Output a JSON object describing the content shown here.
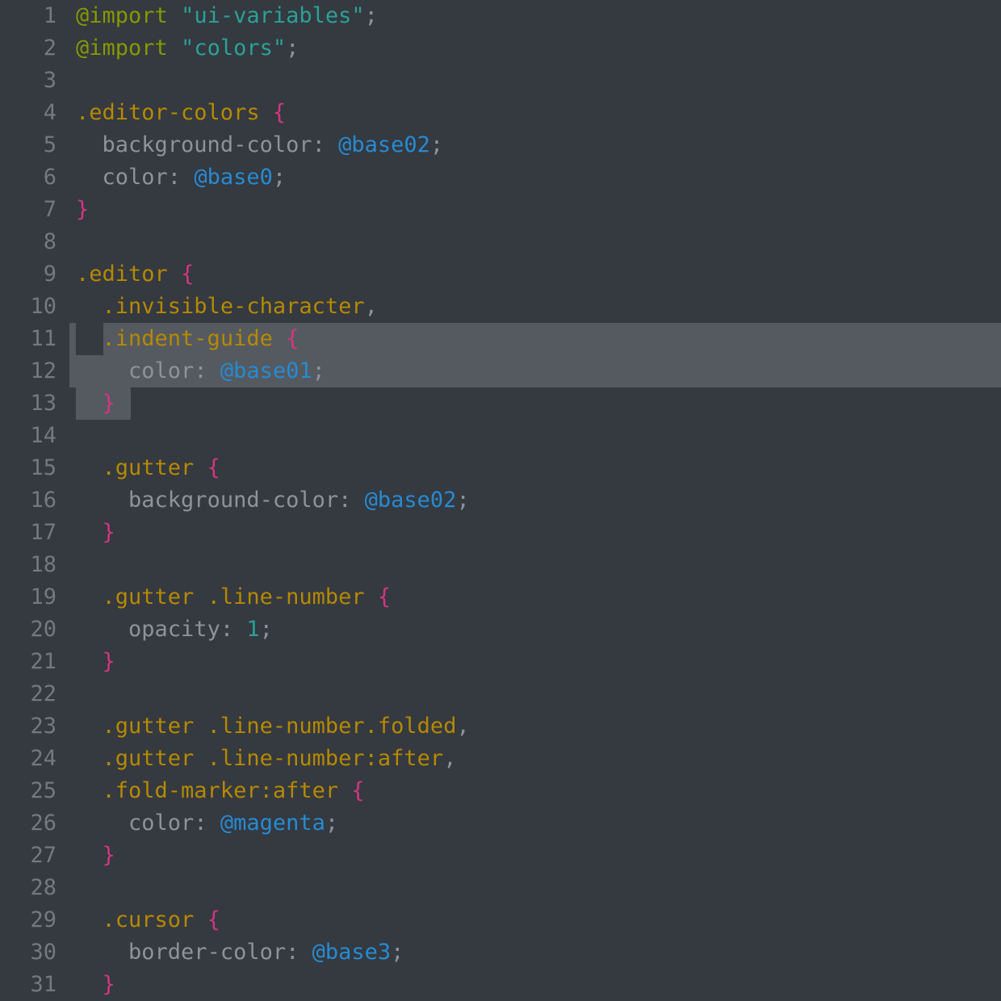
{
  "theme": {
    "background": "#353940",
    "selection": "#555a60",
    "gutterText": "#75797f",
    "defaultText": "#8e9299",
    "keyword": "#d33682",
    "atrule": "#859900",
    "string": "#2aa198",
    "class": "#b58900",
    "variable": "#268bd2",
    "number": "#2aa198"
  },
  "selection": {
    "startLine": 11,
    "endLine": 13
  },
  "lines": [
    {
      "n": 1,
      "indent": "",
      "tokens": [
        [
          "atrule",
          "@import"
        ],
        [
          "punct",
          " "
        ],
        [
          "string",
          "\"ui-variables\""
        ],
        [
          "punct",
          ";"
        ]
      ]
    },
    {
      "n": 2,
      "indent": "",
      "tokens": [
        [
          "atrule",
          "@import"
        ],
        [
          "punct",
          " "
        ],
        [
          "string",
          "\"colors\""
        ],
        [
          "punct",
          ";"
        ]
      ]
    },
    {
      "n": 3,
      "indent": "",
      "tokens": []
    },
    {
      "n": 4,
      "indent": "",
      "tokens": [
        [
          "class",
          ".editor-colors"
        ],
        [
          "punct",
          " "
        ],
        [
          "brace",
          "{"
        ]
      ]
    },
    {
      "n": 5,
      "indent": "  ",
      "tokens": [
        [
          "prop",
          "background-color"
        ],
        [
          "punct",
          ": "
        ],
        [
          "var",
          "@base02"
        ],
        [
          "punct",
          ";"
        ]
      ]
    },
    {
      "n": 6,
      "indent": "  ",
      "tokens": [
        [
          "prop",
          "color"
        ],
        [
          "punct",
          ": "
        ],
        [
          "var",
          "@base0"
        ],
        [
          "punct",
          ";"
        ]
      ]
    },
    {
      "n": 7,
      "indent": "",
      "tokens": [
        [
          "brace",
          "}"
        ]
      ]
    },
    {
      "n": 8,
      "indent": "",
      "tokens": []
    },
    {
      "n": 9,
      "indent": "",
      "tokens": [
        [
          "class",
          ".editor"
        ],
        [
          "punct",
          " "
        ],
        [
          "brace",
          "{"
        ]
      ]
    },
    {
      "n": 10,
      "indent": "  ",
      "tokens": [
        [
          "class",
          ".invisible-character"
        ],
        [
          "punct",
          ","
        ]
      ]
    },
    {
      "n": 11,
      "indent": "  ",
      "tokens": [
        [
          "class",
          ".indent-guide"
        ],
        [
          "punct",
          " "
        ],
        [
          "brace",
          "{"
        ]
      ]
    },
    {
      "n": 12,
      "indent": "    ",
      "tokens": [
        [
          "prop",
          "color"
        ],
        [
          "punct",
          ": "
        ],
        [
          "var",
          "@base01"
        ],
        [
          "punct",
          ";"
        ]
      ]
    },
    {
      "n": 13,
      "indent": "  ",
      "tokens": [
        [
          "brace",
          "}"
        ]
      ]
    },
    {
      "n": 14,
      "indent": "",
      "tokens": []
    },
    {
      "n": 15,
      "indent": "  ",
      "tokens": [
        [
          "class",
          ".gutter"
        ],
        [
          "punct",
          " "
        ],
        [
          "brace",
          "{"
        ]
      ]
    },
    {
      "n": 16,
      "indent": "    ",
      "tokens": [
        [
          "prop",
          "background-color"
        ],
        [
          "punct",
          ": "
        ],
        [
          "var",
          "@base02"
        ],
        [
          "punct",
          ";"
        ]
      ]
    },
    {
      "n": 17,
      "indent": "  ",
      "tokens": [
        [
          "brace",
          "}"
        ]
      ]
    },
    {
      "n": 18,
      "indent": "",
      "tokens": []
    },
    {
      "n": 19,
      "indent": "  ",
      "tokens": [
        [
          "class",
          ".gutter"
        ],
        [
          "punct",
          " "
        ],
        [
          "class",
          ".line-number"
        ],
        [
          "punct",
          " "
        ],
        [
          "brace",
          "{"
        ]
      ]
    },
    {
      "n": 20,
      "indent": "    ",
      "tokens": [
        [
          "prop",
          "opacity"
        ],
        [
          "punct",
          ": "
        ],
        [
          "num",
          "1"
        ],
        [
          "punct",
          ";"
        ]
      ]
    },
    {
      "n": 21,
      "indent": "  ",
      "tokens": [
        [
          "brace",
          "}"
        ]
      ]
    },
    {
      "n": 22,
      "indent": "",
      "tokens": []
    },
    {
      "n": 23,
      "indent": "  ",
      "tokens": [
        [
          "class",
          ".gutter"
        ],
        [
          "punct",
          " "
        ],
        [
          "class",
          ".line-number"
        ],
        [
          "class",
          ".folded"
        ],
        [
          "punct",
          ","
        ]
      ]
    },
    {
      "n": 24,
      "indent": "  ",
      "tokens": [
        [
          "class",
          ".gutter"
        ],
        [
          "punct",
          " "
        ],
        [
          "class",
          ".line-number"
        ],
        [
          "pseudo",
          ":after"
        ],
        [
          "punct",
          ","
        ]
      ]
    },
    {
      "n": 25,
      "indent": "  ",
      "tokens": [
        [
          "class",
          ".fold-marker"
        ],
        [
          "pseudo",
          ":after"
        ],
        [
          "punct",
          " "
        ],
        [
          "brace",
          "{"
        ]
      ]
    },
    {
      "n": 26,
      "indent": "    ",
      "tokens": [
        [
          "prop",
          "color"
        ],
        [
          "punct",
          ": "
        ],
        [
          "var",
          "@magenta"
        ],
        [
          "punct",
          ";"
        ]
      ]
    },
    {
      "n": 27,
      "indent": "  ",
      "tokens": [
        [
          "brace",
          "}"
        ]
      ]
    },
    {
      "n": 28,
      "indent": "",
      "tokens": []
    },
    {
      "n": 29,
      "indent": "  ",
      "tokens": [
        [
          "class",
          ".cursor"
        ],
        [
          "punct",
          " "
        ],
        [
          "brace",
          "{"
        ]
      ]
    },
    {
      "n": 30,
      "indent": "    ",
      "tokens": [
        [
          "prop",
          "border-color"
        ],
        [
          "punct",
          ": "
        ],
        [
          "var",
          "@base3"
        ],
        [
          "punct",
          ";"
        ]
      ]
    },
    {
      "n": 31,
      "indent": "  ",
      "tokens": [
        [
          "brace",
          "}"
        ]
      ]
    }
  ]
}
